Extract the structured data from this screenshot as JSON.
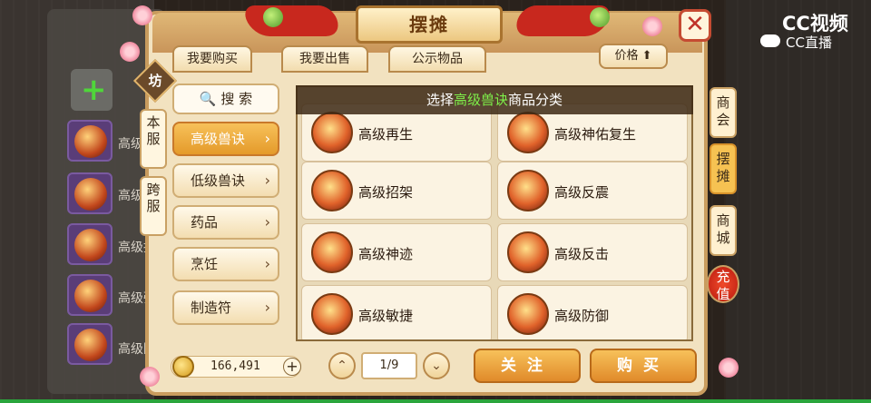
{
  "title": "摆摊",
  "tabs": [
    {
      "label": "我要购买"
    },
    {
      "label": "我要出售"
    },
    {
      "label": "公示物品"
    }
  ],
  "sort_label": "价格",
  "fang_label": "坊",
  "server_tags": [
    {
      "label": "本\n服"
    },
    {
      "label": "跨\n服"
    }
  ],
  "search_label": "搜 索",
  "categories": [
    {
      "label": "高级兽诀",
      "active": true
    },
    {
      "label": "低级兽诀",
      "active": false
    },
    {
      "label": "药品",
      "active": false
    },
    {
      "label": "烹饪",
      "active": false
    },
    {
      "label": "制造符",
      "active": false
    }
  ],
  "grid_header": {
    "prefix": "选择",
    "highlight": "高级兽诀",
    "suffix": "商品分类"
  },
  "items": [
    {
      "name": "高级再生"
    },
    {
      "name": "高级神佑复生"
    },
    {
      "name": "高级招架"
    },
    {
      "name": "高级反震"
    },
    {
      "name": "高级神迹"
    },
    {
      "name": "高级反击"
    },
    {
      "name": "高级敏捷"
    },
    {
      "name": "高级防御"
    }
  ],
  "money": "166,491",
  "page": "1/9",
  "follow_label": "关注",
  "buy_label": "购买",
  "right_nav": [
    {
      "label": "商会"
    },
    {
      "label": "摆摊"
    },
    {
      "label": "商城"
    },
    {
      "label": "充值"
    }
  ],
  "background_list": [
    "高级",
    "高级",
    "高级招",
    "高级强",
    "高级防"
  ],
  "watermark": {
    "line1": "CC视频",
    "line2": "CC直播"
  },
  "colors": {
    "accent": "#e49a2a",
    "highlight": "#7ef04a",
    "close": "#c0322a"
  }
}
